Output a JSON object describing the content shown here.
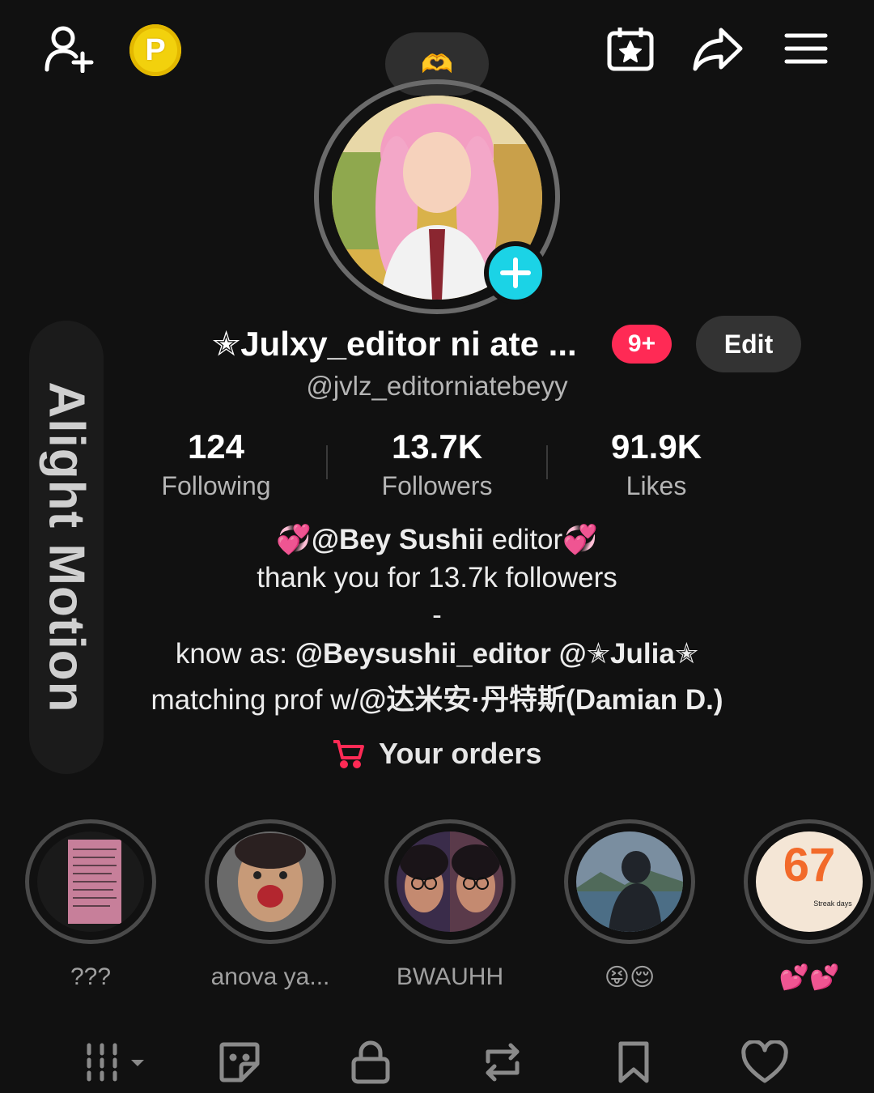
{
  "topbar": {
    "add_friend_icon": "person-add-icon",
    "coin_label": "P",
    "calendar_icon": "calendar-star-icon",
    "share_icon": "share-arrow-icon",
    "menu_icon": "hamburger-menu-icon"
  },
  "note": {
    "emoji": "🫶"
  },
  "watermark": {
    "text": "Alight Motion"
  },
  "profile": {
    "display_name": "✭Julxy_editor ni ate ...",
    "notification_badge": "9+",
    "edit_label": "Edit",
    "username": "@jvlz_editorniatebeyy"
  },
  "stats": [
    {
      "value": "124",
      "label": "Following"
    },
    {
      "value": "13.7K",
      "label": "Followers"
    },
    {
      "value": "91.9K",
      "label": "Likes"
    }
  ],
  "bio": {
    "line1_emoji_left": "💞",
    "line1_mention": "@Bey Sushii",
    "line1_rest": " editor",
    "line1_emoji_right": "💞",
    "line2": "thank you for 13.7k followers",
    "line3": "-",
    "line4_prefix": "know as: ",
    "line4_mentions": "@Beysushii_editor @✭Julia✭",
    "line5_prefix": "matching prof w/",
    "line5_mention": "@达米安·丹特斯(Damian D.)"
  },
  "orders": {
    "label": "Your orders",
    "icon": "shopping-cart-icon"
  },
  "highlights": [
    {
      "label": "???"
    },
    {
      "label": "anova ya..."
    },
    {
      "label": "BWAUHH"
    },
    {
      "label": "😝😌"
    },
    {
      "label": "💕💕",
      "streak_number": "67",
      "streak_text": "Streak days"
    }
  ],
  "tabs": [
    {
      "icon": "grid-dropdown-icon"
    },
    {
      "icon": "sticker-icon"
    },
    {
      "icon": "lock-icon"
    },
    {
      "icon": "repost-icon"
    },
    {
      "icon": "bookmark-icon"
    },
    {
      "icon": "heart-icon"
    }
  ]
}
